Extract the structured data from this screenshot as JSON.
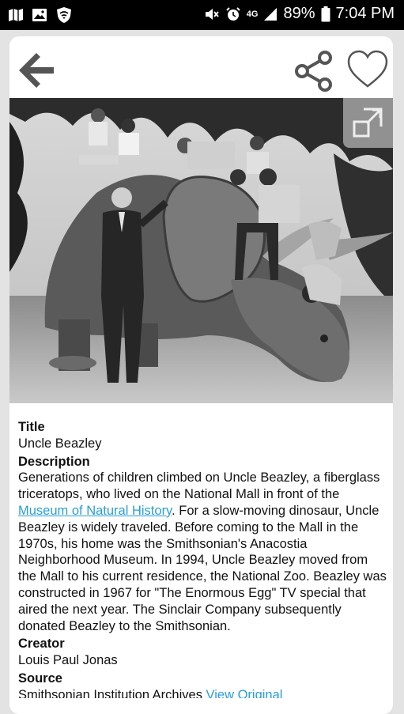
{
  "status_bar": {
    "network": "4G",
    "battery": "89%",
    "time": "7:04 PM",
    "icons": [
      "map-icon",
      "image-icon",
      "shield-icon",
      "mute-icon",
      "alarm-icon",
      "signal-icon",
      "battery-icon"
    ]
  },
  "toolbar": {
    "back_icon": "arrow-left-icon",
    "share_icon": "share-icon",
    "favorite_icon": "heart-outline-icon"
  },
  "photo": {
    "expand_icon": "expand-icon"
  },
  "details": {
    "title_label": "Title",
    "title_value": "Uncle Beazley",
    "description_label": "Description",
    "description_part1": "Generations of children climbed on Uncle Beazley, a fiberglass triceratops, who lived on the National Mall in front of the ",
    "description_link": "Museum of Natural History",
    "description_part2": ". For a slow-moving dinosaur, Uncle Beazley is widely traveled. Before coming to the Mall in the 1970s, his home was the Smithsonian's Anacostia Neighborhood Museum. In 1994, Uncle Beazley moved from the Mall to his current residence, the National Zoo. Beazley was constructed in 1967 for \"The Enormous Egg\" TV special that aired the next year. The Sinclair Company subsequently donated Beazley to the Smithsonian.",
    "creator_label": "Creator",
    "creator_value": "Louis Paul Jonas",
    "source_label": "Source",
    "source_value": "Smithsonian Institution Archives",
    "source_link": "View Original"
  },
  "colors": {
    "link": "#2a9fd6",
    "icon_gray": "#555555",
    "status_bg": "#000000"
  }
}
